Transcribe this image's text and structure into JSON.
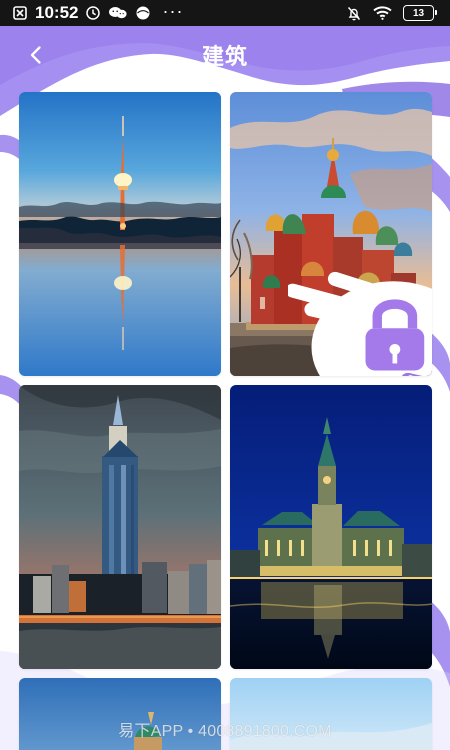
{
  "status_bar": {
    "time": "10:52",
    "battery": "13",
    "more": "···",
    "icons": [
      "close-box-icon",
      "alarm-icon",
      "wechat-icon",
      "ball-icon",
      "silent-bell-icon",
      "wifi-icon",
      "battery-icon"
    ]
  },
  "header": {
    "title": "建筑",
    "back_icon": "chevron-left-icon"
  },
  "gallery": {
    "items": [
      {
        "name": "tv-tower-lake-image",
        "locked": false
      },
      {
        "name": "onion-dome-cathedral-image",
        "locked": true,
        "lock_icon": "lock-icon"
      },
      {
        "name": "skyscraper-city-image",
        "locked": false
      },
      {
        "name": "night-hall-reflection-image",
        "locked": false
      },
      {
        "name": "dome-building-partial-image",
        "locked": false
      },
      {
        "name": "sky-partial-image",
        "locked": false
      }
    ]
  },
  "watermark": {
    "text": "易下APP • 4008891800.COM"
  },
  "colors": {
    "accent": "#a98ef0",
    "header_purple": "#9b84ee",
    "status_bar": "#151515",
    "lock_purple": "#a479ea"
  }
}
